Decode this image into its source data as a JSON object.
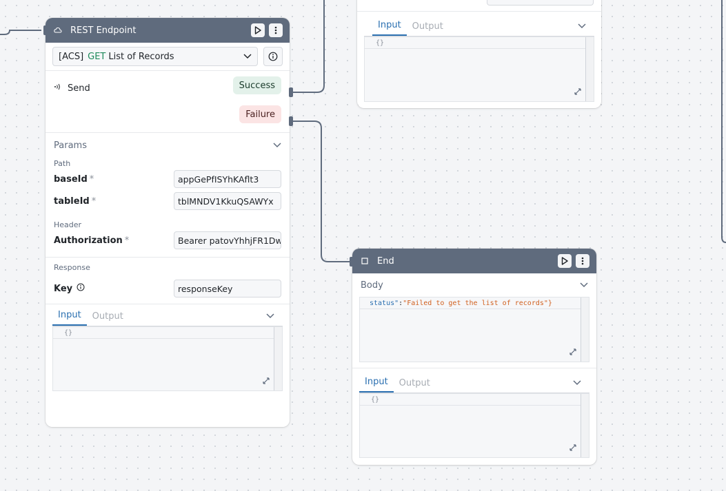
{
  "rest_node": {
    "title": "REST Endpoint",
    "endpoint": {
      "prefix": "[ACS]",
      "method": "GET",
      "name": "List of Records"
    },
    "send_label": "Send",
    "success_label": "Success",
    "failure_label": "Failure",
    "params": {
      "title": "Params",
      "path_label": "Path",
      "path_params": [
        {
          "name": "baseId",
          "required": "*",
          "value": "appGePfISYhKAflt3"
        },
        {
          "name": "tableId",
          "required": "*",
          "value": "tblMNDV1KkuQSAWYx"
        }
      ],
      "header_label": "Header",
      "header_params": [
        {
          "name": "Authorization",
          "required": "*",
          "value": "Bearer patovYhhjFR1Dw"
        }
      ]
    },
    "response": {
      "title": "Response",
      "key_label": "Key",
      "key_value": "responseKey"
    },
    "io": {
      "input_tab": "Input",
      "output_tab": "Output",
      "code": "{}"
    }
  },
  "top_node": {
    "io": {
      "input_tab": "Input",
      "output_tab": "Output",
      "code": "{}"
    }
  },
  "end_node": {
    "title": "End",
    "body": {
      "title": "Body",
      "json_key": "status\"",
      "json_sep": ": ",
      "json_value": "\"Failed to get the list of records\"}"
    },
    "io": {
      "input_tab": "Input",
      "output_tab": "Output",
      "code": "{}"
    }
  },
  "colors": {
    "header_bg": "#5f6b7d",
    "method_get": "#1f8a5b",
    "success_pill": "#e3f1ea",
    "failure_pill": "#fbe4e4",
    "tab_active": "#2a6fb0"
  }
}
